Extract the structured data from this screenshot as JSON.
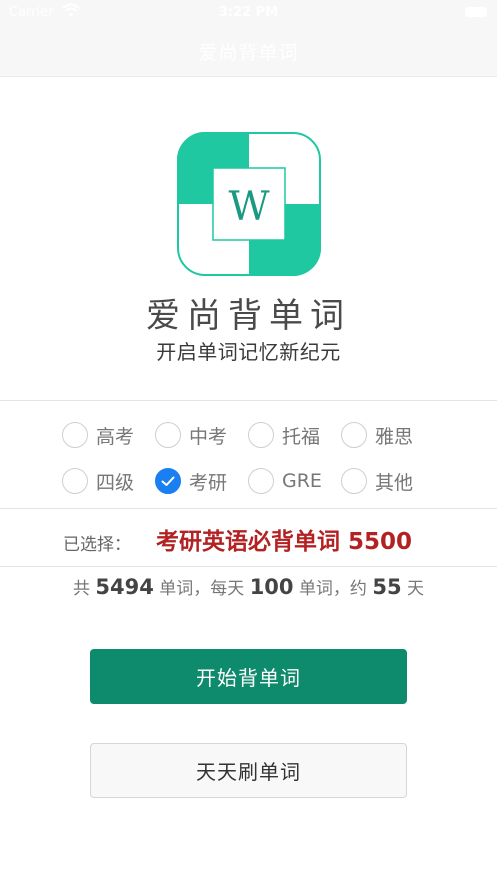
{
  "status_bar": {
    "carrier": "Carrier",
    "time": "3:22 PM"
  },
  "nav": {
    "title": "爱尚背单词"
  },
  "brand": {
    "logo_letter": "W",
    "app_name": "爱尚背单词",
    "slogan": "开启单词记忆新纪元",
    "color": "#1fc8a0"
  },
  "options": [
    {
      "label": "高考",
      "checked": false
    },
    {
      "label": "中考",
      "checked": false
    },
    {
      "label": "托福",
      "checked": false
    },
    {
      "label": "雅思",
      "checked": false
    },
    {
      "label": "四级",
      "checked": false
    },
    {
      "label": "考研",
      "checked": true
    },
    {
      "label": "GRE",
      "checked": false
    },
    {
      "label": "其他",
      "checked": false
    }
  ],
  "selection": {
    "prefix": "已选择：",
    "name": "考研英语必背单词 5500"
  },
  "summary": {
    "t1": "共",
    "total": "5494",
    "t2": "单词，每天",
    "daily": "100",
    "t3": "单词，约",
    "days": "55",
    "t4": "天"
  },
  "buttons": {
    "start": "开始背单词",
    "review": "天天刷单词"
  },
  "colors": {
    "primary": "#0e8a6c",
    "accent": "#b32222",
    "radio_checked": "#1a7ff0"
  }
}
